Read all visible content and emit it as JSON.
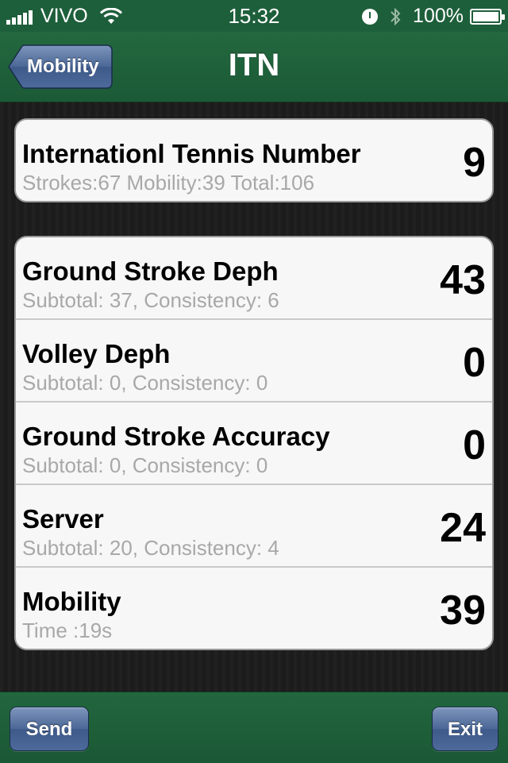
{
  "status_bar": {
    "carrier": "VIVO",
    "time": "15:32",
    "battery": "100%",
    "signal_icon": "signal-bars-icon",
    "wifi_icon": "wifi-icon",
    "alarm_icon": "alarm-clock-icon",
    "bluetooth_icon": "bluetooth-icon",
    "battery_icon": "battery-icon"
  },
  "nav": {
    "title": "ITN",
    "back_label": "Mobility"
  },
  "summary": {
    "title": "Internationl Tennis Number",
    "subtitle": "Strokes:67 Mobility:39 Total:106",
    "value": "9"
  },
  "details": [
    {
      "title": "Ground Stroke Deph",
      "subtitle": "Subtotal: 37, Consistency: 6",
      "value": "43"
    },
    {
      "title": "Volley Deph",
      "subtitle": "Subtotal: 0, Consistency: 0",
      "value": "0"
    },
    {
      "title": "Ground Stroke Accuracy",
      "subtitle": "Subtotal: 0, Consistency: 0",
      "value": "0"
    },
    {
      "title": "Server",
      "subtitle": "Subtotal: 20, Consistency: 4",
      "value": "24"
    },
    {
      "title": "Mobility",
      "subtitle": "Time :19s",
      "value": "39"
    }
  ],
  "toolbar": {
    "send_label": "Send",
    "exit_label": "Exit"
  },
  "colors": {
    "bar_green": "#1e5f3b",
    "button_blue": "#4b6796",
    "background": "#1c1c1c"
  }
}
